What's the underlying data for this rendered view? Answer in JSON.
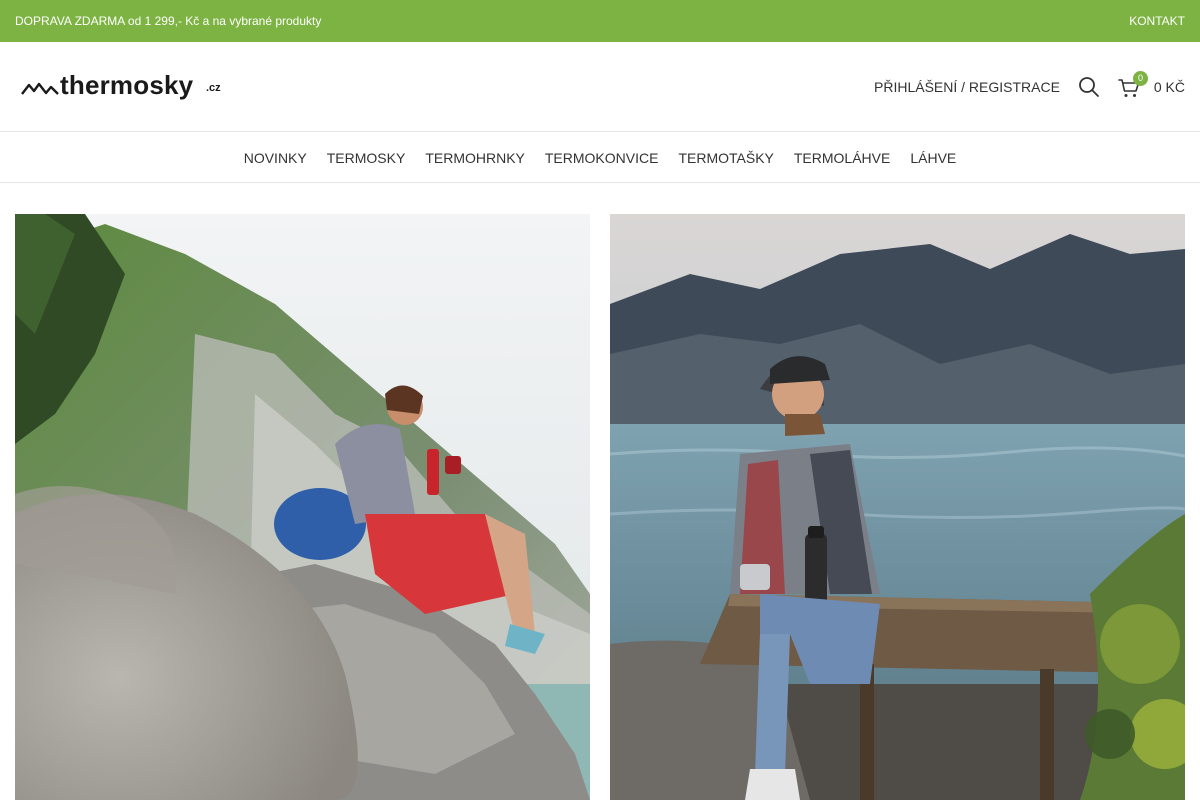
{
  "topbar": {
    "promo": "DOPRAVA ZDARMA od 1 299,- Kč a na vybrané produkty",
    "contact": "KONTAKT",
    "color": "#7cb342"
  },
  "header": {
    "logo_text": "thermosky",
    "logo_tld": ".cz",
    "login_label": "PŘIHLÁŠENÍ / REGISTRACE",
    "cart_count": "0",
    "cart_total": "0 KČ"
  },
  "nav": {
    "items": [
      "NOVINKY",
      "TERMOSKY",
      "TERMOHRNKY",
      "TERMOKONVICE",
      "TERMOTAŠKY",
      "TERMOLÁHVE",
      "LÁHVE"
    ]
  },
  "banners": [
    {
      "icon": "photo-woman-with-red-thermos-on-rock"
    },
    {
      "icon": "photo-man-with-black-thermos-on-pier"
    }
  ]
}
